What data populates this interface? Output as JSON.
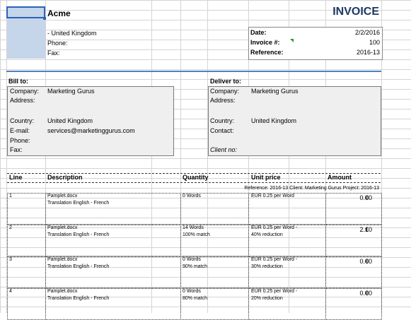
{
  "company": {
    "name": "Acme",
    "country_line": "- United Kingdom",
    "phone_label": "Phone:",
    "fax_label": "Fax:"
  },
  "invoice": {
    "title": "INVOICE",
    "date_label": "Date:",
    "date_value": "2/2/2016",
    "number_label": "Invoice #:",
    "number_value": "100",
    "reference_label": "Reference:",
    "reference_value": "2016-13"
  },
  "bill_to": {
    "heading": "Bill to:",
    "company_label": "Company:",
    "company_value": "Marketing Gurus",
    "address_label": "Address:",
    "country_label": "Country:",
    "country_value": "United Kingdom",
    "email_label": "E-mail:",
    "email_value": "services@marketinggurus.com",
    "phone_label": "Phone:",
    "fax_label": "Fax:"
  },
  "deliver_to": {
    "heading": "Deliver to:",
    "company_label": "Company:",
    "company_value": "Marketing Gurus",
    "address_label": "Address:",
    "country_label": "Country:",
    "country_value": "United Kingdom",
    "contact_label": "Contact:",
    "client_no_label": "Client no:"
  },
  "table": {
    "headers": [
      "Line",
      "Description",
      "Quantity",
      "Unit price",
      "Amount"
    ],
    "subheader": "Reference: 2016-13   Client: Marketing Gurus   Project: 2016-13",
    "currency": "€",
    "rows": [
      {
        "line": "1",
        "desc1": "Pamplet.docx",
        "desc2": "Translation English - French",
        "qty1": "0 Words",
        "qty2": "",
        "price1": "EUR 0.25 per Word",
        "price2": "",
        "amount": "0.00"
      },
      {
        "line": "2",
        "desc1": "Pamplet.docx",
        "desc2": "Translation English - French",
        "qty1": "14 Words",
        "qty2": "100% match",
        "price1": "EUR 0.25 per Word  -",
        "price2": "40% reduction",
        "amount": "2.10"
      },
      {
        "line": "3",
        "desc1": "Pamplet.docx",
        "desc2": "Translation English - French",
        "qty1": "0 Words",
        "qty2": "90% match",
        "price1": "EUR 0.25 per Word  -",
        "price2": "30% reduction",
        "amount": "0.00"
      },
      {
        "line": "4",
        "desc1": "Pamplet.docx",
        "desc2": "Translation English - French",
        "qty1": "0 Words",
        "qty2": "80% match",
        "price1": "EUR 0.25 per Word  -",
        "price2": "20% reduction",
        "amount": "0.00"
      }
    ]
  },
  "colors": {
    "selection_fill": "#c5d5ea",
    "accent_blue": "#1f3864",
    "rule_blue": "#4f81bd",
    "box_fill": "#efefef",
    "comment_marker": "#2e9a2e"
  }
}
